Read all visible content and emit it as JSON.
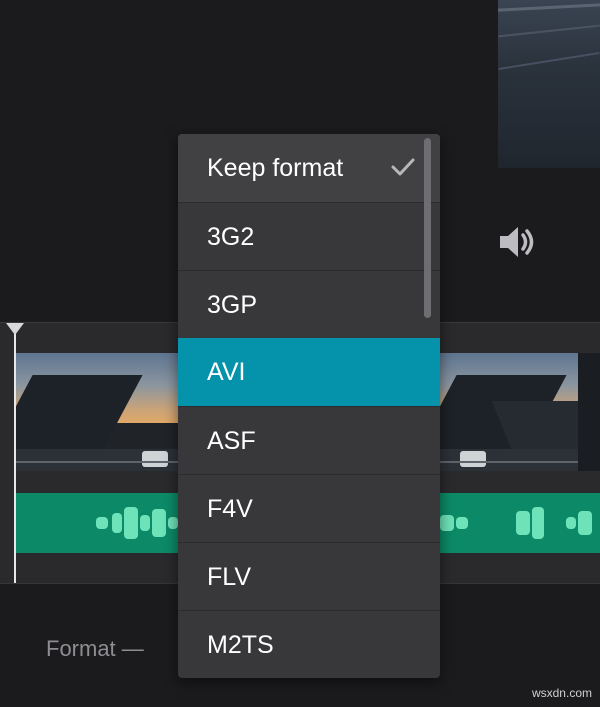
{
  "format_selector": {
    "label": "Format —",
    "options": [
      {
        "label": "Keep format",
        "checked": true
      },
      {
        "label": "3G2"
      },
      {
        "label": "3GP"
      },
      {
        "label": "AVI",
        "highlighted": true
      },
      {
        "label": "ASF"
      },
      {
        "label": "F4V"
      },
      {
        "label": "FLV"
      },
      {
        "label": "M2TS"
      }
    ]
  },
  "icons": {
    "volume": "speaker-icon",
    "check": "check-icon",
    "playhead": "playhead-triangle-icon"
  },
  "colors": {
    "accent": "#0592ab",
    "audio_track": "#0c8a67",
    "waveform": "#6ee2b8",
    "menu_bg": "#38383b"
  },
  "watermark": "wsxdn.com"
}
